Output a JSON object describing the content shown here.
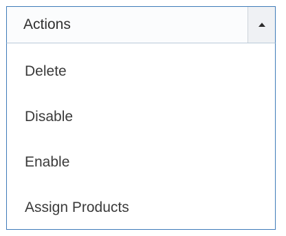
{
  "dropdown": {
    "selected_label": "Actions",
    "arrow_icon": "caret-up-icon",
    "options": [
      {
        "label": "Delete"
      },
      {
        "label": "Disable"
      },
      {
        "label": "Enable"
      },
      {
        "label": "Assign Products"
      }
    ]
  },
  "colors": {
    "border": "#3d7ab8",
    "text": "#303030"
  }
}
